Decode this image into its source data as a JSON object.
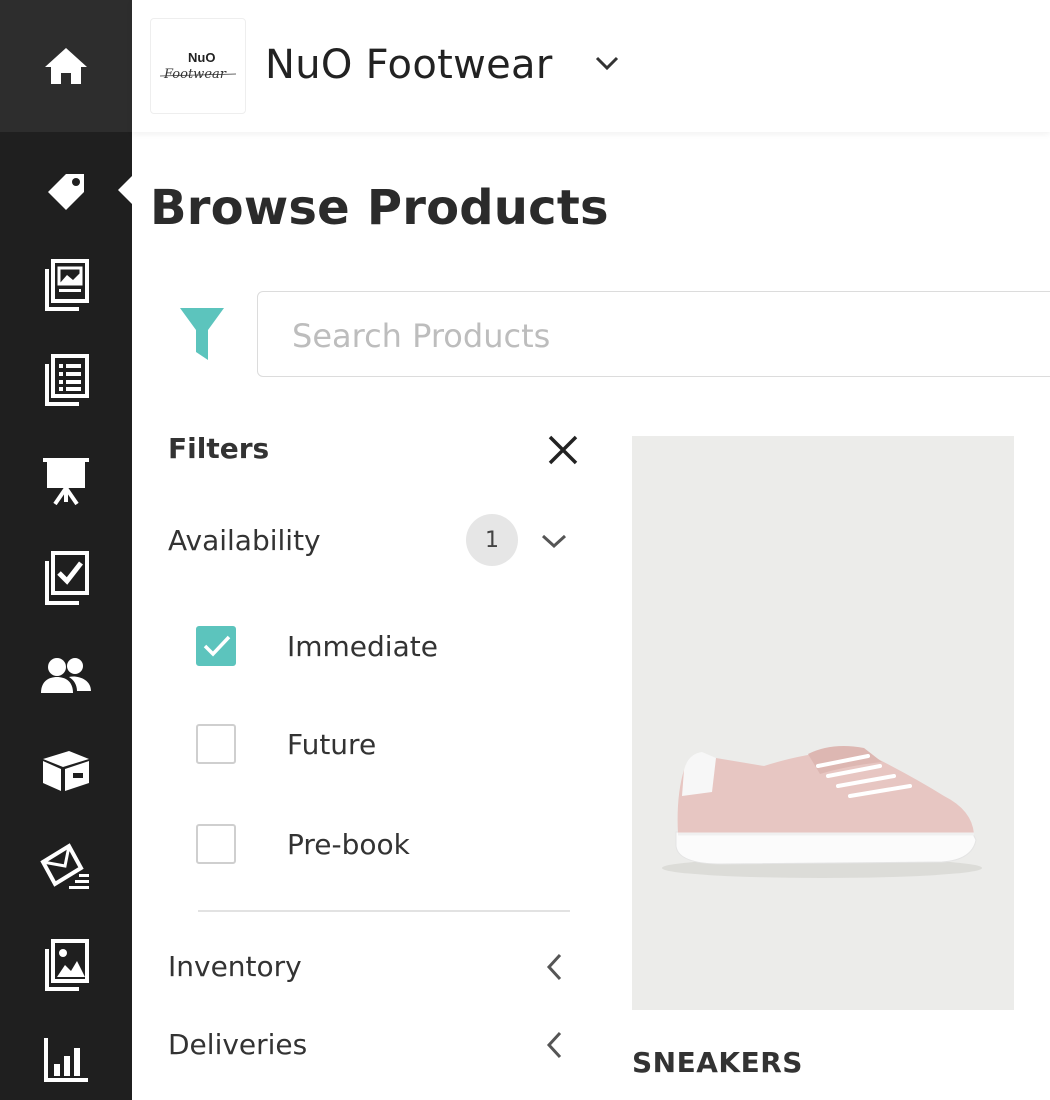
{
  "header": {
    "logo_line1": "NuO",
    "logo_line2": "Footwear",
    "brand_name": "NuO Footwear"
  },
  "page": {
    "title": "Browse Products"
  },
  "search": {
    "placeholder": "Search Products",
    "value": ""
  },
  "filters": {
    "heading": "Filters",
    "groups": [
      {
        "label": "Availability",
        "count": "1",
        "expanded": true,
        "options": [
          {
            "label": "Immediate",
            "checked": true
          },
          {
            "label": "Future",
            "checked": false
          },
          {
            "label": "Pre-book",
            "checked": false
          }
        ]
      },
      {
        "label": "Inventory",
        "expanded": false
      },
      {
        "label": "Deliveries",
        "expanded": false
      }
    ]
  },
  "products": [
    {
      "name": "SNEAKERS",
      "image": "pink-sneaker"
    }
  ],
  "sidebar": {
    "icons": [
      "home-icon",
      "tag-icon",
      "catalog-icon",
      "list-icon",
      "presentation-icon",
      "checklist-icon",
      "users-icon",
      "box-icon",
      "mail-icon",
      "gallery-icon",
      "chart-icon"
    ],
    "active": "tag-icon"
  },
  "colors": {
    "accent": "#5cc4bd",
    "sidebar_bg": "#1f1f1f",
    "sidebar_home_bg": "#2d2d2d"
  }
}
